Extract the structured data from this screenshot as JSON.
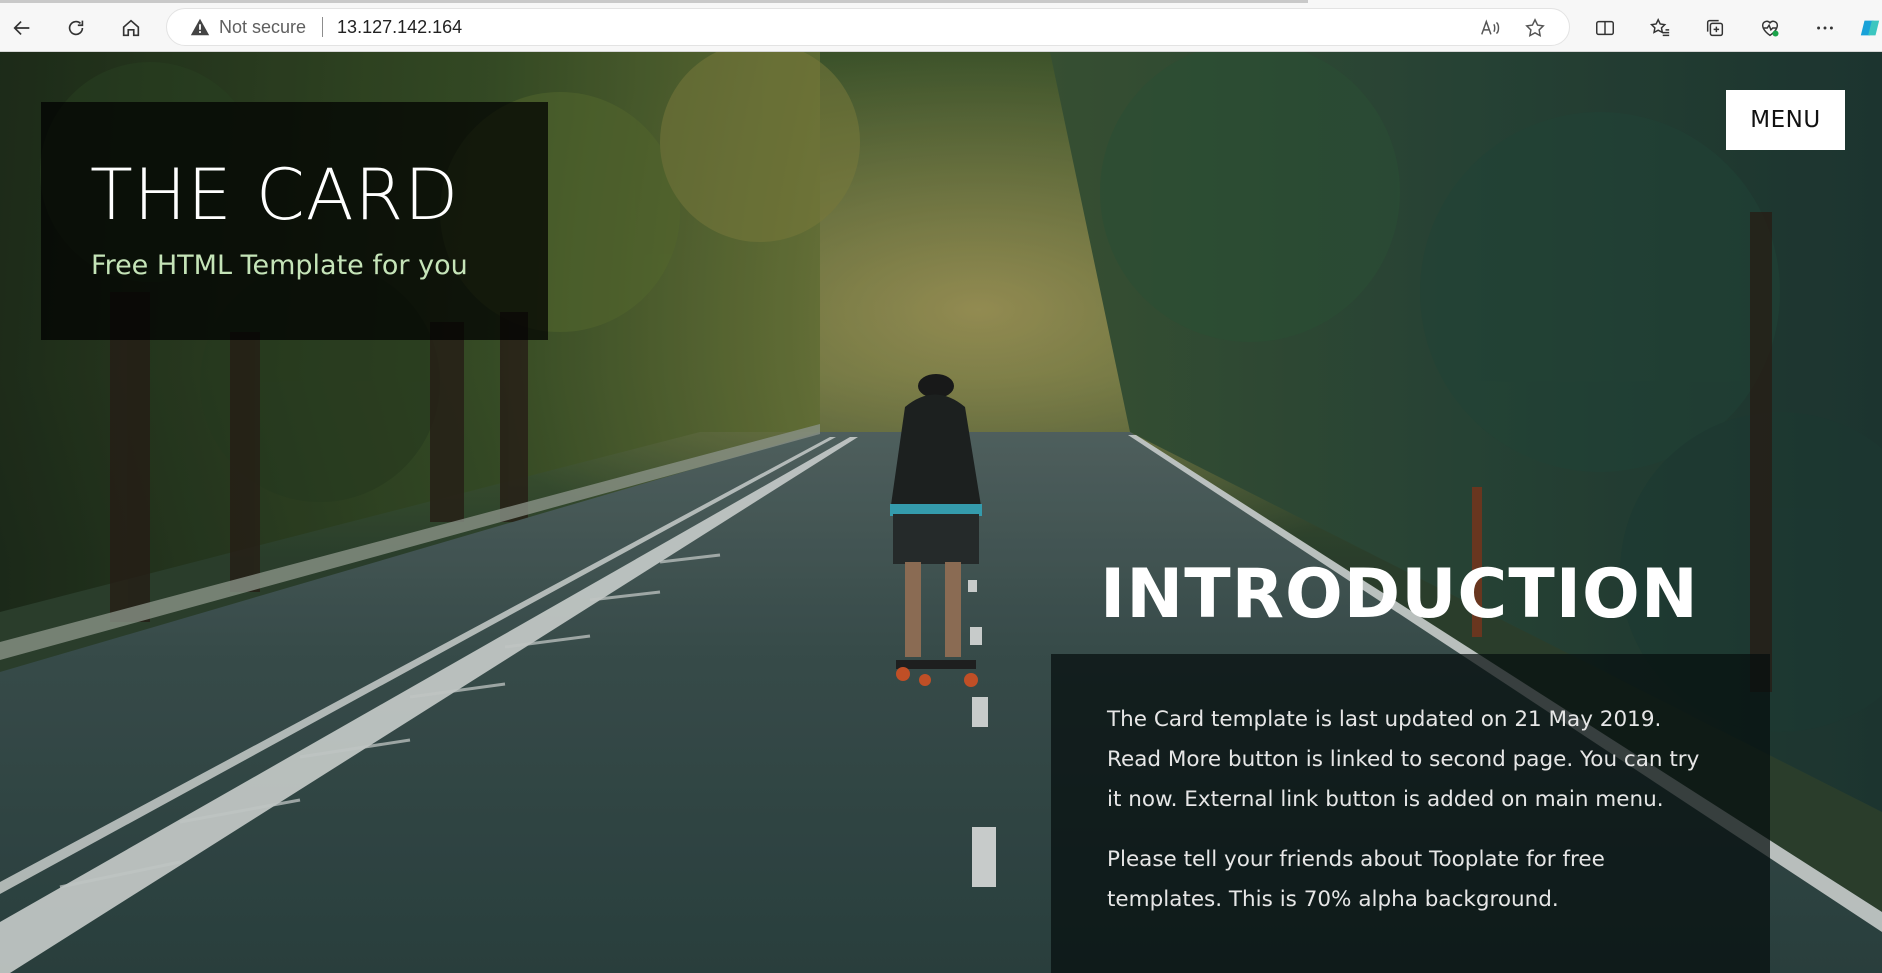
{
  "browser": {
    "security_label": "Not secure",
    "url": "13.127.142.164",
    "icons": {
      "back": "back-arrow-icon",
      "refresh": "refresh-icon",
      "home": "home-icon",
      "warning": "warning-triangle-icon",
      "read_aloud": "read-aloud-icon",
      "favorite": "star-icon",
      "split": "split-screen-icon",
      "favorites": "favorites-icon",
      "collections": "collections-icon",
      "performance": "heart-pulse-icon",
      "more": "more-dots-icon"
    }
  },
  "site": {
    "title": "THE CARD",
    "subtitle": "Free HTML Template for you",
    "menu_label": "MENU"
  },
  "intro": {
    "heading": "INTRODUCTION",
    "paragraph1": "The Card template is last updated on 21 May 2019. Read More button is linked to second page. You can try it now. External link button is added on main menu.",
    "paragraph2": "Please tell your friends about Tooplate for free templates. This is 70% alpha background."
  },
  "colors": {
    "subtitle": "#c5e4b8",
    "panel_overlay": "rgba(0,0,0,0.72)",
    "menu_bg": "#ffffff"
  }
}
